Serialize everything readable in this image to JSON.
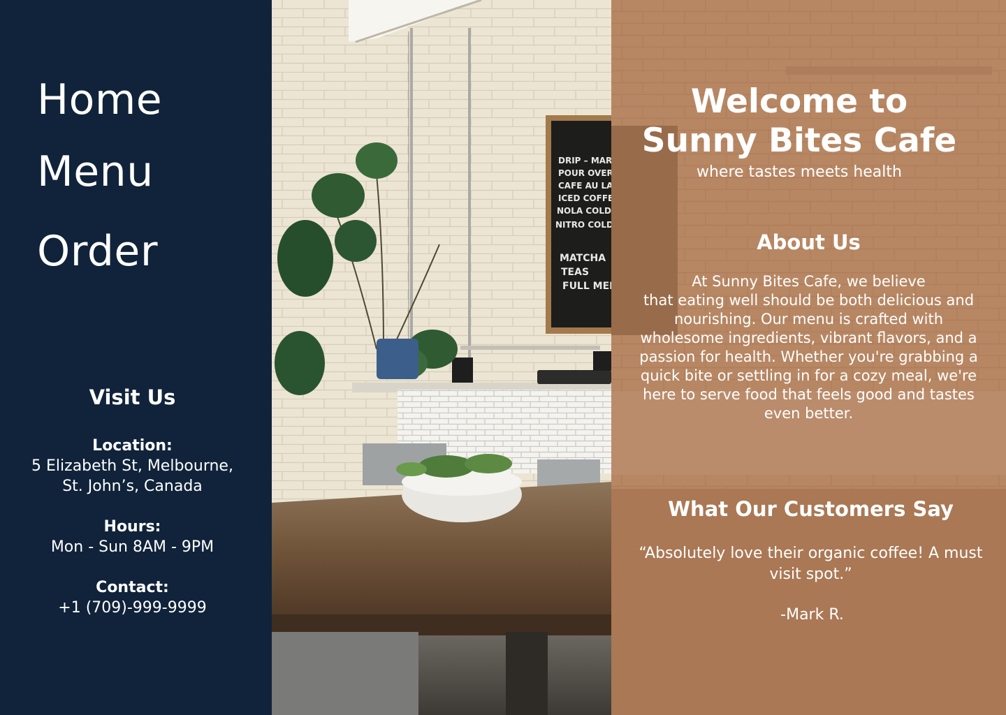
{
  "nav": {
    "home": "Home",
    "menu": "Menu",
    "order": "Order"
  },
  "visit": {
    "heading": "Visit Us",
    "location_label": "Location:",
    "location_line1": "5 Elizabeth St, Melbourne,",
    "location_line2": "St. John’s, Canada",
    "hours_label": "Hours:",
    "hours_value": "Mon - Sun 8AM - 9PM",
    "contact_label": "Contact:",
    "contact_value": "+1 (709)-999-9999"
  },
  "photo": {
    "board_lines": [
      "DRIP – MARKET",
      "POUR OVER",
      "CAFE AU LAIT",
      "ICED COFFEE",
      "NOLA COLD BREW",
      "NITRO COLD BREW",
      "",
      "MATCHA",
      "TEAS",
      "FULL MENU"
    ]
  },
  "hero": {
    "title_line1": "Welcome to",
    "title_line2": "Sunny Bites Cafe",
    "tagline": "where tastes meets health"
  },
  "about": {
    "heading": "About Us",
    "lines": [
      "At Sunny Bites Cafe, we believe",
      "that eating well should be both delicious and",
      "nourishing. Our menu is crafted with",
      "wholesome ingredients, vibrant flavors, and a",
      "passion for health. Whether you're grabbing a",
      "quick bite or settling in for a cozy meal, we're",
      "here to serve food that feels good and tastes",
      "even better."
    ]
  },
  "testimonials": {
    "heading": "What Our Customers Say",
    "quote_line1": "“Absolutely love their organic coffee! A must",
    "quote_line2": "visit spot.”",
    "author": "-Mark R."
  },
  "colors": {
    "sidebar": "#10233a",
    "overlay": "#b47c56",
    "text": "#ffffff"
  }
}
